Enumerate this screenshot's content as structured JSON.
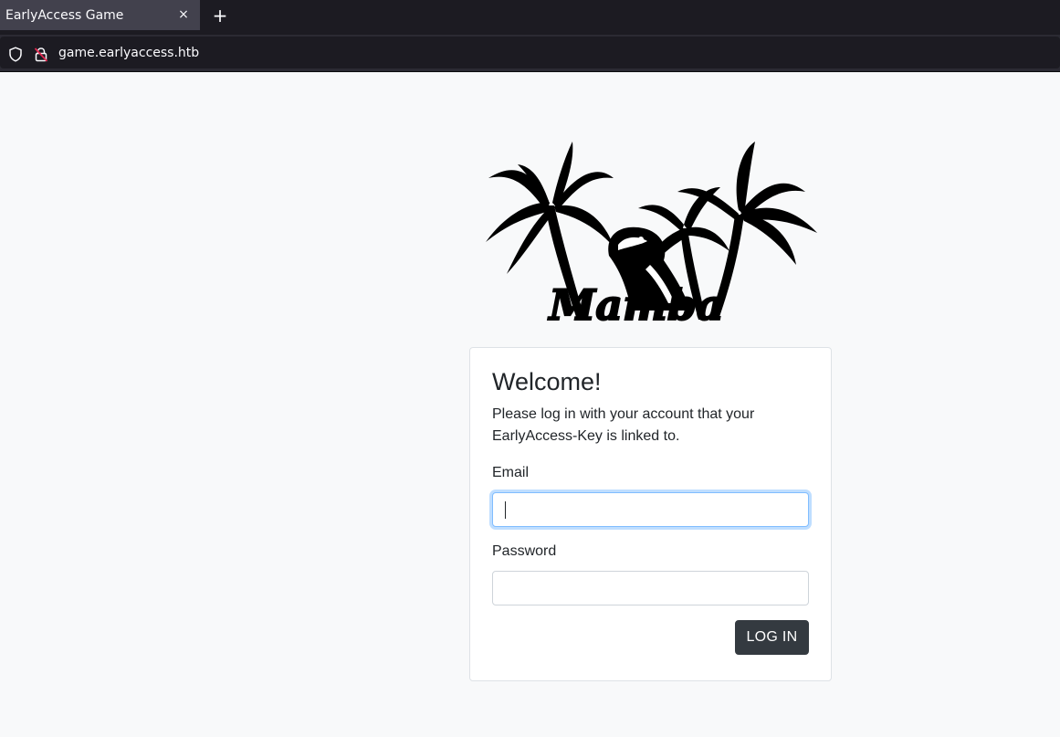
{
  "browser": {
    "tab_title": "EarlyAccess Game",
    "tab_close": "×",
    "new_tab": "+",
    "url": "game.earlyaccess.htb"
  },
  "logo": {
    "text": "Mamba"
  },
  "login": {
    "title": "Welcome!",
    "description": "Please log in with your account that your EarlyAccess-Key is linked to.",
    "email_label": "Email",
    "email_value": "",
    "password_label": "Password",
    "password_value": "",
    "submit_label": "LOG IN"
  },
  "colors": {
    "button": "#343a40",
    "focus_border": "#80bdff",
    "page_background": "#f8f9fa"
  }
}
